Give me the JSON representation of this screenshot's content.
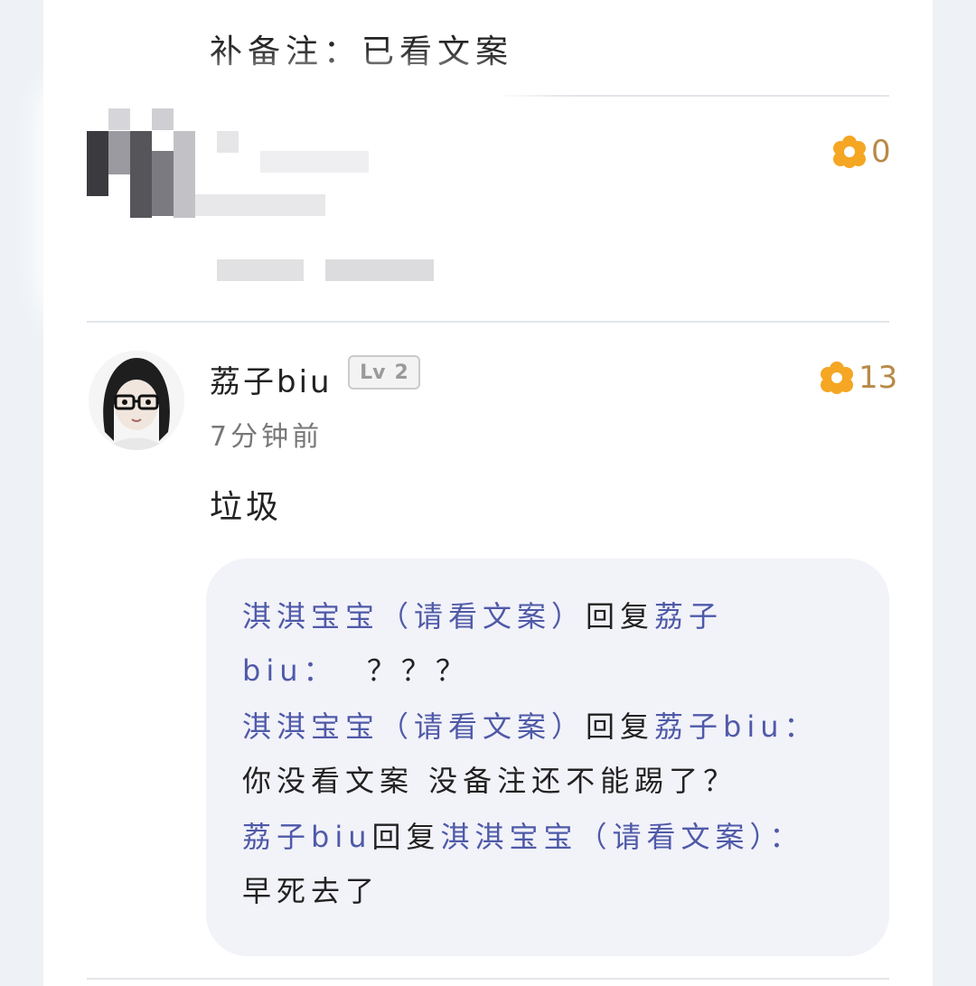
{
  "top_note": "补备注：已看文案",
  "redacted_comment": {
    "likes": "0"
  },
  "comment": {
    "username": "荔子biu",
    "level_prefix": "Lv",
    "level": "2",
    "time": "7分钟前",
    "likes": "13",
    "text": "垃圾"
  },
  "replies": [
    {
      "from": "淇淇宝宝（请看文案）",
      "action": "回复",
      "to": "荔子biu",
      "sep": "：",
      "text": "？？？"
    },
    {
      "from": "淇淇宝宝（请看文案）",
      "action": "回复",
      "to": "荔子biu",
      "sep": "：",
      "text": "你没看文案 没备注还不能踢了？"
    },
    {
      "from": "荔子biu",
      "action": "回复",
      "to": "淇淇宝宝（请看文案）",
      "sep": "：",
      "text": "早死去了"
    }
  ],
  "colors": {
    "accent_like": "#f5a623",
    "reply_name": "#4f5aa8",
    "reply_bg": "#f2f2f9"
  }
}
